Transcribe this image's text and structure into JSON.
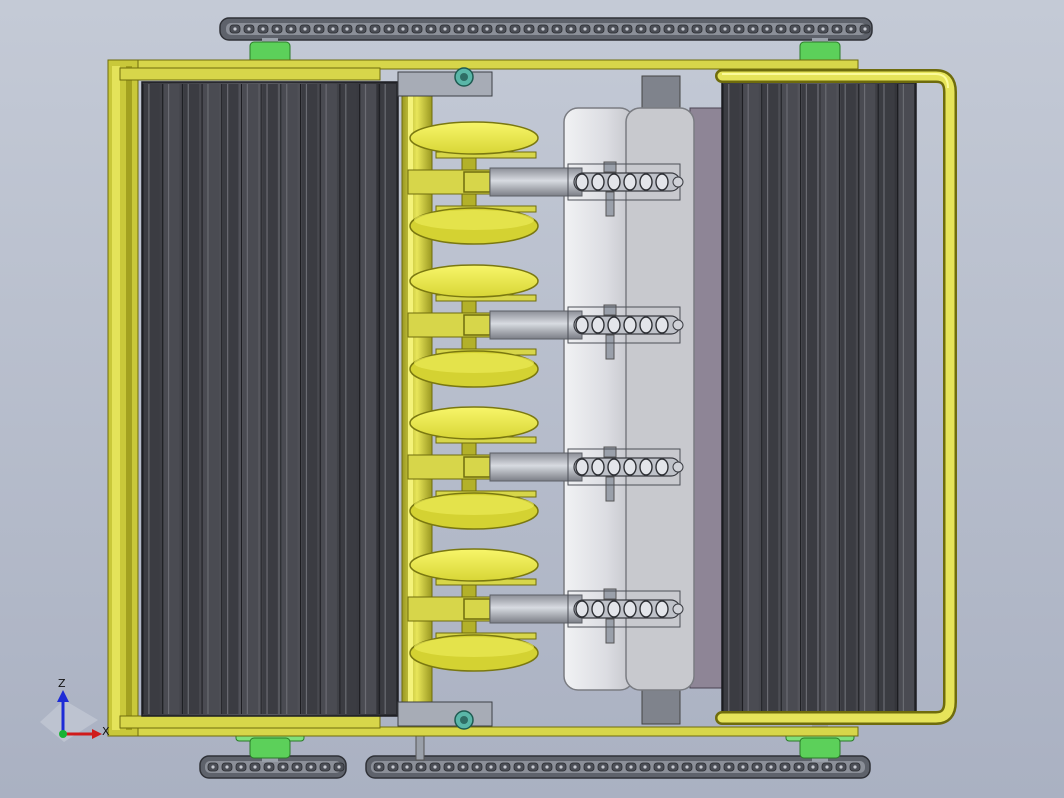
{
  "viewport": {
    "background_top": "#c4cad6",
    "background_bottom": "#aab1c2"
  },
  "colors": {
    "frame": "#c9c83a",
    "frame_dark": "#8f8c14",
    "frame_light": "#e4e35a",
    "disc": "#f0ee4a",
    "disc_edge": "#7a7810",
    "roller_dark": "#2c2d33",
    "roller_mid": "#55565d",
    "sprocket_green": "#5cd05a",
    "bearing_teal": "#5ab6a8",
    "chain": "#6b6f78",
    "shaft": "#b9bcc4",
    "housing": "#e2e3e7",
    "housing_side": "#8e8596"
  },
  "model": {
    "units": 4,
    "roller_ribs": 13
  },
  "triad": {
    "z_label": "Z",
    "x_label": "X",
    "icon": "coordinate-triad-icon"
  }
}
